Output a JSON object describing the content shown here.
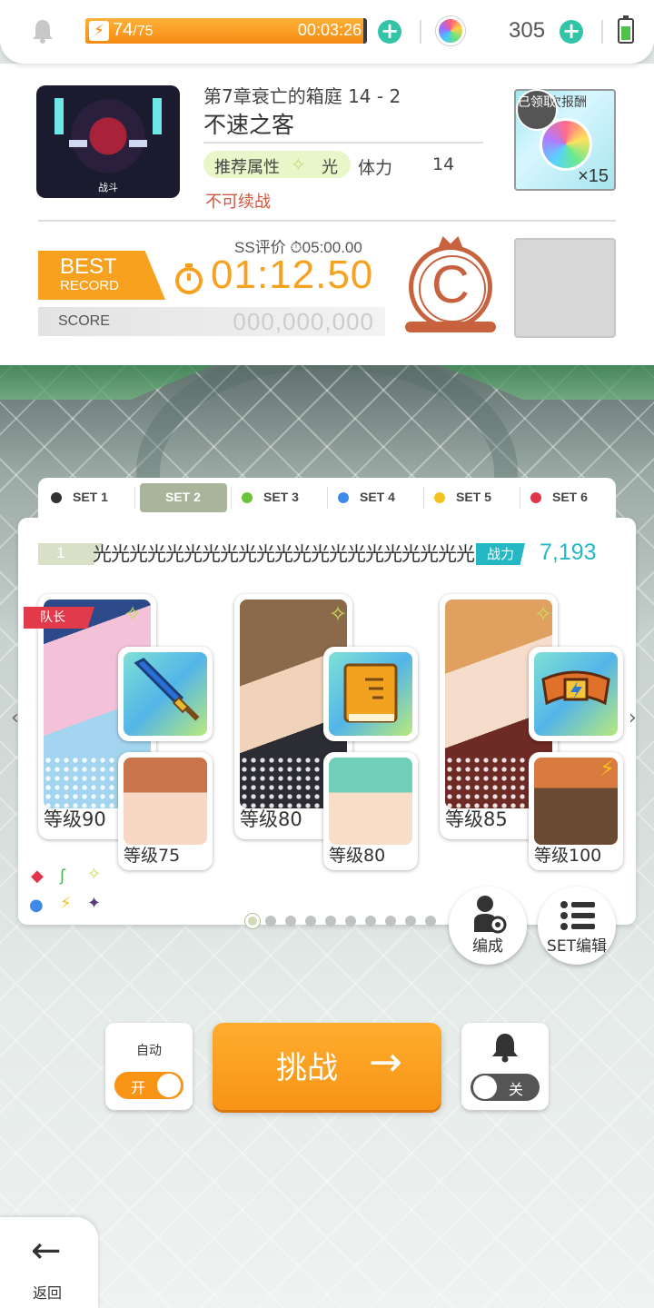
{
  "status_bar": {
    "stamina_current": "74",
    "stamina_max": "/75",
    "stamina_fraction": 0.987,
    "stamina_timer": "00:03:26",
    "gem_count": "305",
    "battery_level": 0.7
  },
  "quest": {
    "thumb_caption": "战斗",
    "chapter": "第7章衰亡的箱庭 14 - 2",
    "title": "不速之客",
    "recommended_label": "推荐属性",
    "recommended_value": "光",
    "stamina_label": "体力",
    "stamina_value": "14",
    "no_continue": "不可续战",
    "reward_label": "次报酬",
    "reward_claimed": "已领取",
    "reward_multiplier": "×15",
    "ss_eval": "SS评价 ⏱05:00.00",
    "best_line1": "BEST",
    "best_line2": "RECORD",
    "best_time": "01:12.50",
    "score_label": "SCORE",
    "score_value": "000,000,000",
    "rank": "C"
  },
  "sets": {
    "tabs": [
      {
        "label": "SET 1",
        "color": "#333333"
      },
      {
        "label": "SET 2",
        "color": "#a8b59a"
      },
      {
        "label": "SET 3",
        "color": "#6cc43c"
      },
      {
        "label": "SET 4",
        "color": "#3f8ae8"
      },
      {
        "label": "SET 5",
        "color": "#f4c21c"
      },
      {
        "label": "SET 6",
        "color": "#e2344a"
      }
    ],
    "active_index": 1
  },
  "party": {
    "number": "1",
    "name": "光光光光光光光光光光光光光光光光光光光光光",
    "power_label": "战力",
    "power_value": "7,193",
    "leader_label": "队长",
    "members": [
      {
        "level": "等级90",
        "sub_level": "等级75",
        "equip_icon": "sword-icon"
      },
      {
        "level": "等级80",
        "sub_level": "等级80",
        "equip_icon": "book-icon"
      },
      {
        "level": "等级85",
        "sub_level": "等级100",
        "equip_icon": "belt-icon"
      }
    ],
    "page_count": 10,
    "page_active": 0
  },
  "actions": {
    "formation_label": "编成",
    "set_edit_label": "SET编辑",
    "auto_label": "自动",
    "auto_toggle": "开",
    "challenge_label": "挑战",
    "challenge_arrow": "→",
    "notify_toggle": "关",
    "back_arrow": "←",
    "back_label": "返回"
  }
}
